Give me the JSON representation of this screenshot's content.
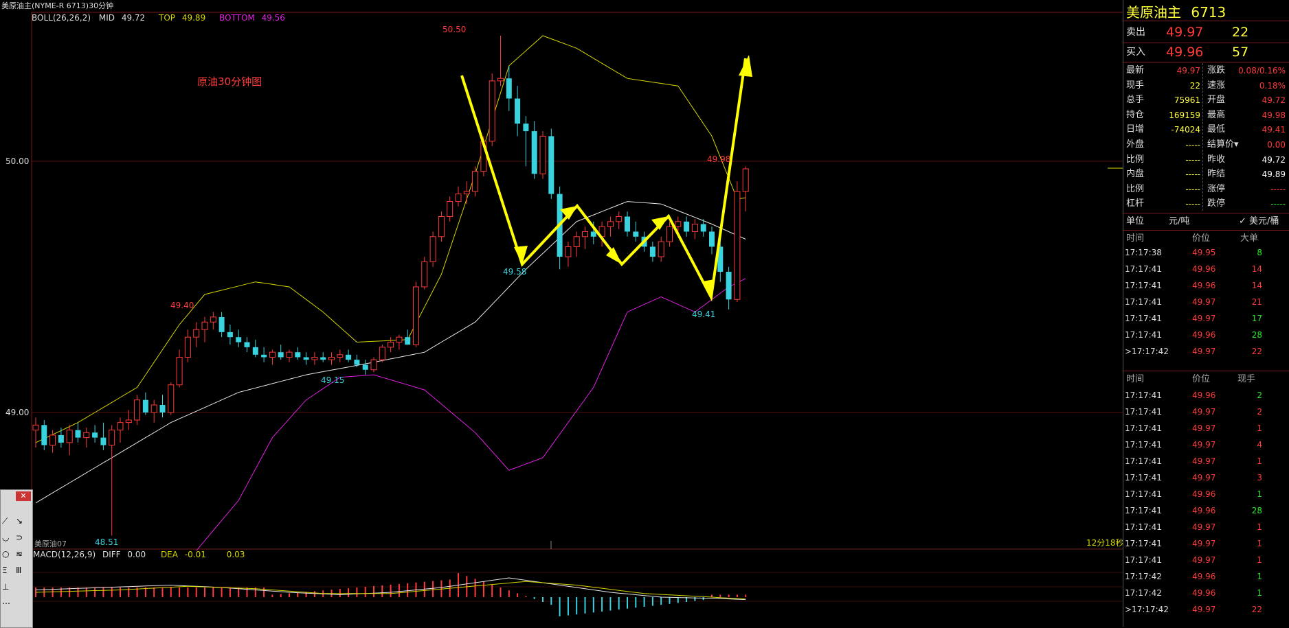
{
  "window_title": "美原油主(NYME-R 6713)30分钟",
  "boll": {
    "label": "BOLL(26,26,2)",
    "mid_label": "MID",
    "mid": "49.72",
    "top_label": "TOP",
    "top": "49.89",
    "bottom_label": "BOTTOM",
    "bottom": "49.56"
  },
  "annotation": "原油30分钟图",
  "price_levels": {
    "high": "50.00",
    "low": "49.00"
  },
  "price_marks": {
    "peak": "50.50",
    "p1": "49.40",
    "p2": "49.15",
    "p3": "49.58",
    "p4": "49.41",
    "p5": "49.98",
    "p6": "48.51"
  },
  "footer_left": "美原油07",
  "footer_right": "12分18秒",
  "macd": {
    "label": "MACD(12,26,9)",
    "diff_label": "DIFF",
    "diff": "0.00",
    "dea_label": "DEA",
    "dea": "-0.01",
    "macd_val": "0.03"
  },
  "panel": {
    "name": "美原油主",
    "code": "6713",
    "sell_label": "卖出",
    "sell_price": "49.97",
    "sell_qty": "22",
    "buy_label": "买入",
    "buy_price": "49.96",
    "buy_qty": "57",
    "stats": [
      {
        "l1": "最新",
        "v1": "49.97",
        "c1": "red",
        "l2": "涨跌",
        "v2": "0.08/0.16%",
        "c2": "red"
      },
      {
        "l1": "现手",
        "v1": "22",
        "c1": "yellow",
        "l2": "速涨",
        "v2": "0.18%",
        "c2": "red"
      },
      {
        "l1": "总手",
        "v1": "75961",
        "c1": "yellow",
        "l2": "开盘",
        "v2": "49.72",
        "c2": "red"
      },
      {
        "l1": "持仓",
        "v1": "169159",
        "c1": "yellow",
        "l2": "最高",
        "v2": "49.98",
        "c2": "red"
      },
      {
        "l1": "日增",
        "v1": "-74024",
        "c1": "yellow",
        "l2": "最低",
        "v2": "49.41",
        "c2": "red"
      },
      {
        "l1": "外盘",
        "v1": "-----",
        "c1": "yellow",
        "l2": "结算价▾",
        "v2": "0.00",
        "c2": "red"
      },
      {
        "l1": "比例",
        "v1": "-----",
        "c1": "yellow",
        "l2": "昨收",
        "v2": "49.72",
        "c2": "white"
      },
      {
        "l1": "内盘",
        "v1": "-----",
        "c1": "yellow",
        "l2": "昨结",
        "v2": "49.89",
        "c2": "white"
      },
      {
        "l1": "比例",
        "v1": "-----",
        "c1": "yellow",
        "l2": "涨停",
        "v2": "-----",
        "c2": "red"
      },
      {
        "l1": "杠杆",
        "v1": "-----",
        "c1": "yellow",
        "l2": "跌停",
        "v2": "-----",
        "c2": "green"
      }
    ],
    "unit_label": "单位",
    "unit_value": "元/吨",
    "unit_alt": "✓ 美元/桶",
    "big_orders_header": {
      "time": "时间",
      "price": "价位",
      "qty": "大单"
    },
    "big_orders": [
      {
        "time": "17:17:38",
        "price": "49.95",
        "qty": "8",
        "qc": "green"
      },
      {
        "time": "17:17:41",
        "price": "49.96",
        "qty": "14",
        "qc": "red"
      },
      {
        "time": "17:17:41",
        "price": "49.96",
        "qty": "14",
        "qc": "red"
      },
      {
        "time": "17:17:41",
        "price": "49.97",
        "qty": "21",
        "qc": "red"
      },
      {
        "time": "17:17:41",
        "price": "49.97",
        "qty": "17",
        "qc": "green"
      },
      {
        "time": "17:17:41",
        "price": "49.96",
        "qty": "28",
        "qc": "green"
      },
      {
        "time": ">17:17:42",
        "price": "49.97",
        "qty": "22",
        "qc": "red"
      }
    ],
    "ticks_header": {
      "time": "时间",
      "price": "价位",
      "qty": "现手"
    },
    "ticks": [
      {
        "time": "17:17:41",
        "price": "49.96",
        "qty": "2",
        "qc": "green"
      },
      {
        "time": "17:17:41",
        "price": "49.97",
        "qty": "2",
        "qc": "red"
      },
      {
        "time": "17:17:41",
        "price": "49.97",
        "qty": "1",
        "qc": "red"
      },
      {
        "time": "17:17:41",
        "price": "49.97",
        "qty": "4",
        "qc": "red"
      },
      {
        "time": "17:17:41",
        "price": "49.97",
        "qty": "1",
        "qc": "red"
      },
      {
        "time": "17:17:41",
        "price": "49.97",
        "qty": "3",
        "qc": "red"
      },
      {
        "time": "17:17:41",
        "price": "49.96",
        "qty": "1",
        "qc": "green"
      },
      {
        "time": "17:17:41",
        "price": "49.96",
        "qty": "28",
        "qc": "green"
      },
      {
        "time": "17:17:41",
        "price": "49.97",
        "qty": "1",
        "qc": "red"
      },
      {
        "time": "17:17:41",
        "price": "49.97",
        "qty": "1",
        "qc": "red"
      },
      {
        "time": "17:17:41",
        "price": "49.97",
        "qty": "1",
        "qc": "red"
      },
      {
        "time": "17:17:42",
        "price": "49.96",
        "qty": "1",
        "qc": "green"
      },
      {
        "time": "17:17:42",
        "price": "49.96",
        "qty": "1",
        "qc": "green"
      },
      {
        "time": ">17:17:42",
        "price": "49.97",
        "qty": "22",
        "qc": "red"
      }
    ]
  },
  "toolbox": {
    "close": "✕"
  },
  "colors": {
    "up": "#ff3b3b",
    "down": "#39d3e0",
    "mid": "#e8e8e8",
    "top": "#d6d600",
    "bottom": "#e020e0",
    "arrow": "#ffff00",
    "grid": "#7a1a1a"
  }
}
